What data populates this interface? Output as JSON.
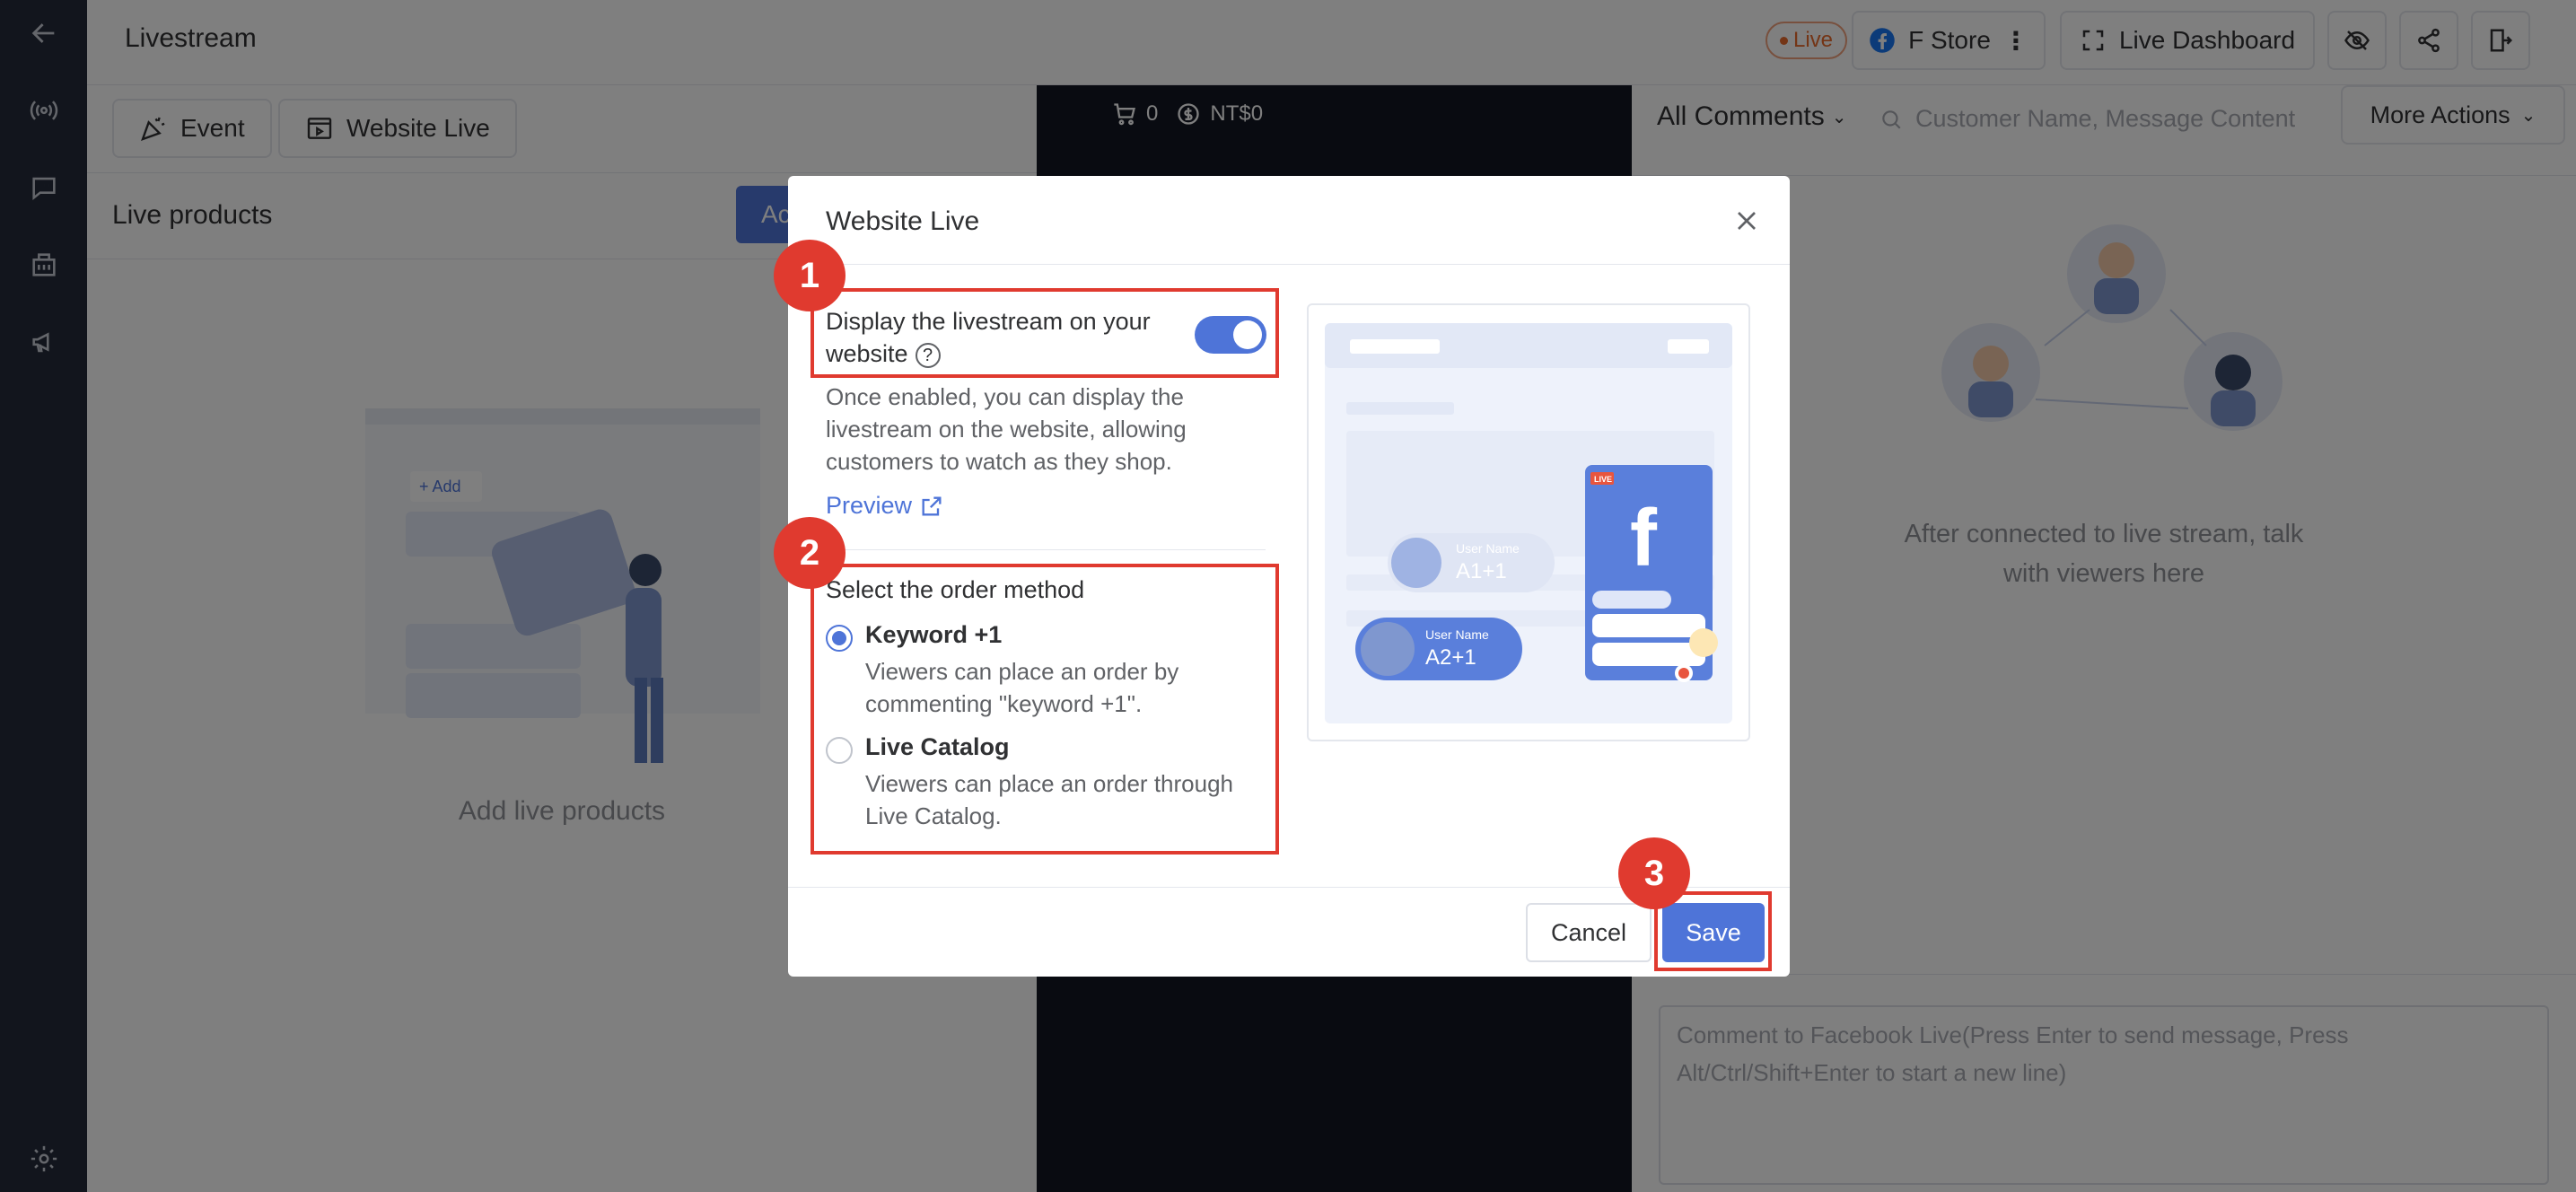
{
  "app": {
    "title": "Livestream",
    "live_badge": "Live",
    "store_name": "F Store",
    "dashboard_label": "Live Dashboard"
  },
  "tabs": [
    {
      "label": "Event"
    },
    {
      "label": "Website Live"
    }
  ],
  "left_panel": {
    "title": "Live products",
    "add_button": "Ac",
    "empty_label": "Add live products",
    "illus_add": "+ Add"
  },
  "video_panel": {
    "cart_count": "0",
    "amount": "NT$0"
  },
  "right_panel": {
    "filter": "All Comments",
    "search_placeholder": "Customer Name, Message Content",
    "more_actions": "More Actions",
    "empty_line1": "After connected to live stream, talk",
    "empty_line2": "with viewers here",
    "comment_line1": "Comment to Facebook Live(Press Enter to send message, Press",
    "comment_line2": "Alt/Ctrl/Shift+Enter to start a new line)"
  },
  "modal": {
    "title": "Website Live",
    "toggle_label_line1": "Display the livestream on your",
    "toggle_label_line2": "website",
    "toggle_on": true,
    "desc_line1": "Once enabled, you can display the",
    "desc_line2": "livestream on the website, allowing",
    "desc_line3": "customers to watch as they shop.",
    "preview_link": "Preview",
    "order_title": "Select the order method",
    "options": [
      {
        "label": "Keyword +1",
        "desc_line1": "Viewers can place an order by",
        "desc_line2": "commenting \"keyword +1\".",
        "checked": true
      },
      {
        "label": "Live Catalog",
        "desc_line1": "Viewers can place an order through",
        "desc_line2": "Live Catalog.",
        "checked": false
      }
    ],
    "illustration": {
      "bubble1_user": "User Name",
      "bubble1_text": "A1+1",
      "bubble2_user": "User Name",
      "bubble2_text": "A2+1",
      "live_tag": "LIVE"
    },
    "cancel": "Cancel",
    "save": "Save"
  },
  "annotations": [
    "1",
    "2",
    "3"
  ],
  "colors": {
    "accent": "#4e74d8",
    "annotation": "#e03a2f",
    "sidebar": "#252b3a"
  }
}
